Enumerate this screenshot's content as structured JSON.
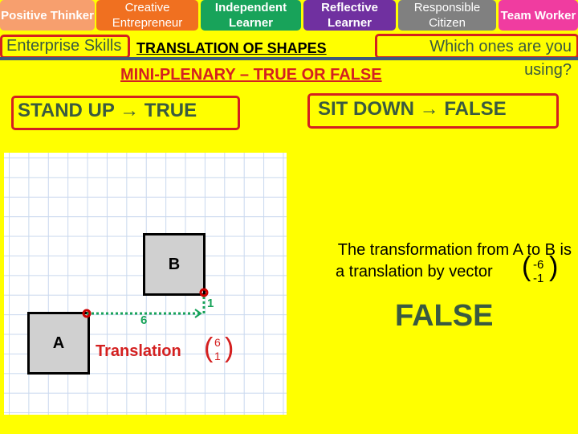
{
  "skills": [
    {
      "label": "Positive Thinker",
      "color": "#f79f6e"
    },
    {
      "label": "Creative Entrepreneur",
      "color": "#f07020"
    },
    {
      "label": "Independent Learner",
      "color": "#18a35a"
    },
    {
      "label": "Reflective Learner",
      "color": "#7030a0"
    },
    {
      "label": "Responsible Citizen",
      "color": "#808080"
    },
    {
      "label": "Team Worker",
      "color": "#f03ca0"
    }
  ],
  "enterprise_label": "Enterprise Skills",
  "title": "TRANSLATION OF SHAPES",
  "question": "Which ones are you using?",
  "subtitle": "MINI-PLENARY – TRUE OR FALSE",
  "stand_up": "STAND UP → TRUE",
  "sit_down": "SIT DOWN → FALSE",
  "diagram": {
    "shape_a": "A",
    "shape_b": "B",
    "horizontal": "6",
    "vertical": "1",
    "translation_label": "Translation",
    "vector_top": "6",
    "vector_bottom": "1"
  },
  "statement": {
    "line1": "The transformation from A to B is",
    "line2": "a translation by vector",
    "vector_top": "-6",
    "vector_bottom": "-1"
  },
  "answer": "FALSE"
}
